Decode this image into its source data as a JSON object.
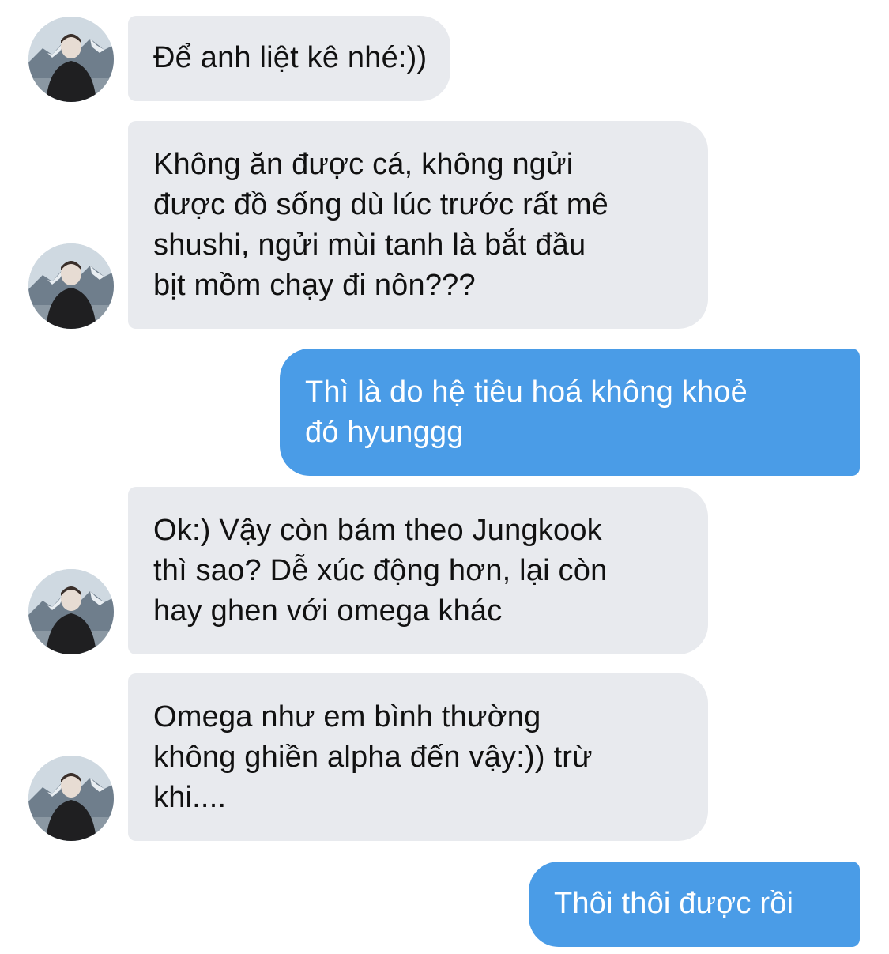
{
  "messages": [
    {
      "sender": "them",
      "text": "Để anh liệt kê nhé:))"
    },
    {
      "sender": "them",
      "text": "Không ăn được cá, không ngửi\nđược đồ sống dù lúc trước rất mê\nshushi, ngửi mùi tanh là bắt đầu\nbịt mồm chạy đi nôn???"
    },
    {
      "sender": "me",
      "text": "Thì là do hệ tiêu hoá không khoẻ\nđó hyunggg"
    },
    {
      "sender": "them",
      "text": "Ok:) Vậy còn bám theo Jungkook\nthì sao? Dễ xúc động hơn, lại còn\nhay ghen với omega khác"
    },
    {
      "sender": "them",
      "text": "Omega như em bình thường\nkhông ghiền alpha đến vậy:)) trừ\nkhi...."
    },
    {
      "sender": "me",
      "text": "Thôi thôi được rồi"
    }
  ],
  "colors": {
    "incoming_bubble": "#e8eaee",
    "outgoing_bubble": "#4a9ce7",
    "incoming_text": "#111111",
    "outgoing_text": "#ffffff"
  },
  "icons": {
    "contact_avatar": "avatar-photo-person-mountains"
  }
}
